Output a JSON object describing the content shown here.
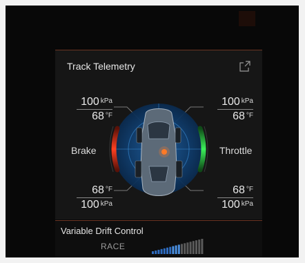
{
  "panel": {
    "title": "Track Telemetry"
  },
  "tires": {
    "front_left": {
      "pressure": "100",
      "pressure_unit": "kPa",
      "temp": "68",
      "temp_unit": "°F"
    },
    "front_right": {
      "pressure": "100",
      "pressure_unit": "kPa",
      "temp": "68",
      "temp_unit": "°F"
    },
    "rear_left": {
      "pressure": "100",
      "pressure_unit": "kPa",
      "temp": "68",
      "temp_unit": "°F"
    },
    "rear_right": {
      "pressure": "100",
      "pressure_unit": "kPa",
      "temp": "68",
      "temp_unit": "°F"
    }
  },
  "brake": {
    "label": "Brake",
    "color": "#e8361c"
  },
  "throttle": {
    "label": "Throttle",
    "color": "#2fd24a"
  },
  "drift": {
    "title": "Variable Drift Control",
    "mode": "RACE",
    "level": 10,
    "total": 18
  },
  "icons": {
    "export": "export-icon",
    "car": "car-top-view-icon"
  },
  "colors": {
    "accent_line": "#6b3422",
    "gauge_blue": "#1e5a9a"
  }
}
